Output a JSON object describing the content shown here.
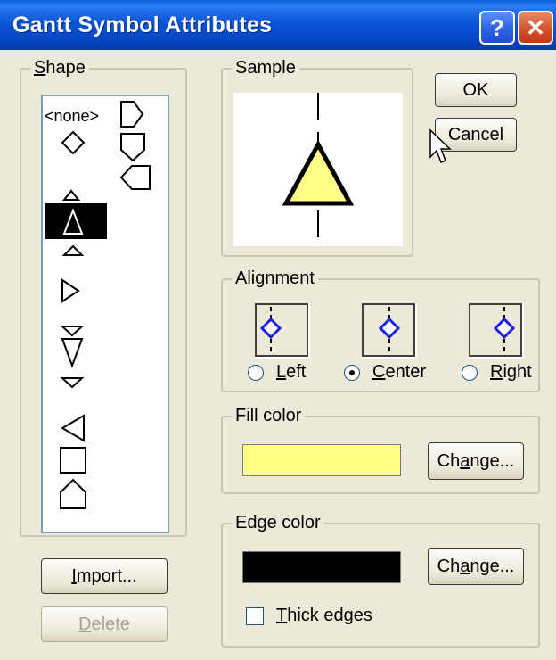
{
  "window": {
    "title": "Gantt Symbol Attributes",
    "help_glyph": "?",
    "close_glyph": "✕"
  },
  "shape_group": {
    "legend_underlined": "S",
    "legend_rest": "hape",
    "none_label": "<none>",
    "selected_shape": "triangle"
  },
  "sample_group": {
    "legend": "Sample",
    "fill": "#ffff88",
    "edge": "#000000"
  },
  "buttons": {
    "ok": "OK",
    "cancel": "Cancel",
    "import_u": "I",
    "import_rest": "mport...",
    "delete_u": "D",
    "delete_rest": "elete"
  },
  "alignment_group": {
    "legend": "Alignment",
    "options": [
      {
        "u": "L",
        "rest": "eft",
        "selected": false
      },
      {
        "u": "C",
        "rest": "enter",
        "selected": true
      },
      {
        "u": "R",
        "rest": "ight",
        "selected": false
      }
    ]
  },
  "fill_group": {
    "legend": "Fill color",
    "color": "#ffff88",
    "change_pre": "Ch",
    "change_u": "a",
    "change_rest": "nge..."
  },
  "edge_group": {
    "legend": "Edge color",
    "color": "#000000",
    "change_pre": "Ch",
    "change_u": "a",
    "change_rest": "nge...",
    "thick_u": "T",
    "thick_rest": "hick edges",
    "thick_checked": false
  }
}
